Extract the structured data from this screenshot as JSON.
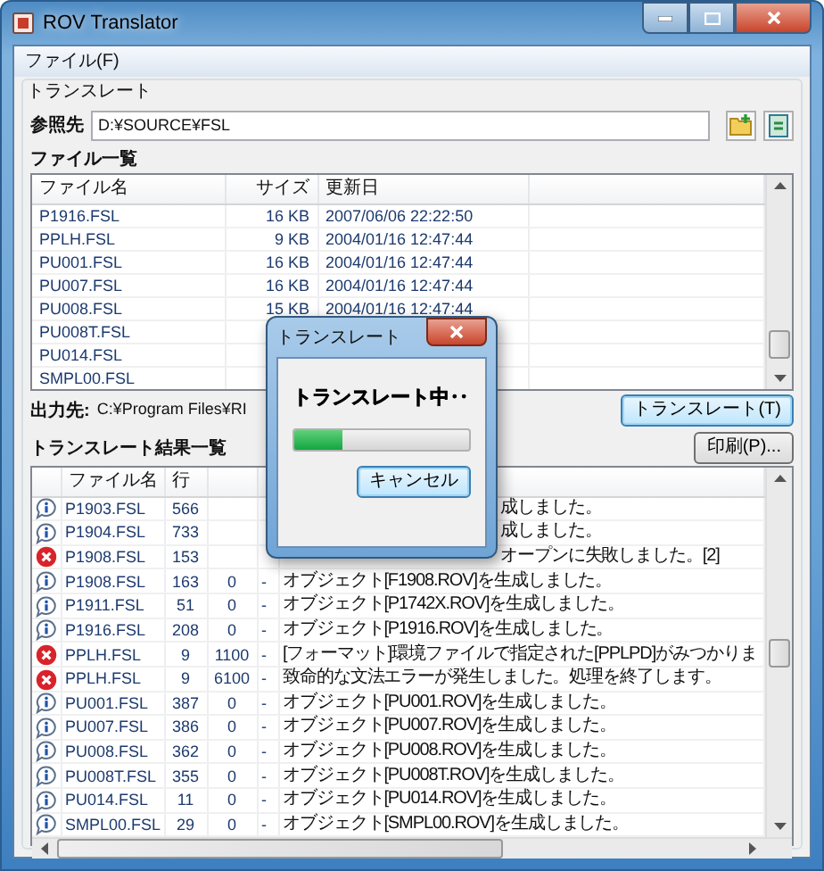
{
  "window": {
    "title": "ROV Translator"
  },
  "menu": [
    "ファイル(F)"
  ],
  "group": {
    "label": "トランスレート"
  },
  "source": {
    "label": "参照先",
    "value": "D:¥SOURCE¥FSL"
  },
  "file_list": {
    "title": "ファイル一覧",
    "columns": [
      "ファイル名",
      "サイズ",
      "更新日"
    ],
    "rows": [
      {
        "name": "P1916.FSL",
        "size": "16 KB",
        "date": "2007/06/06 22:22:50"
      },
      {
        "name": "PPLH.FSL",
        "size": "9 KB",
        "date": "2004/01/16 12:47:44"
      },
      {
        "name": "PU001.FSL",
        "size": "16 KB",
        "date": "2004/01/16 12:47:44"
      },
      {
        "name": "PU007.FSL",
        "size": "16 KB",
        "date": "2004/01/16 12:47:44"
      },
      {
        "name": "PU008.FSL",
        "size": "15 KB",
        "date": "2004/01/16 12:47:44"
      },
      {
        "name": "PU008T.FSL"
      },
      {
        "name": "PU014.FSL"
      },
      {
        "name": "SMPL00.FSL"
      }
    ]
  },
  "output": {
    "label": "出力先:",
    "value": "C:¥Program Files¥RI"
  },
  "translate_button": "トランスレート(T)",
  "print_button": "印刷(P)...",
  "results": {
    "title": "トランスレート結果一覧",
    "columns": [
      "ファイル名",
      "行"
    ],
    "rows": [
      {
        "kind": "info",
        "file": "P1903.FSL",
        "lines": "566",
        "message": "成しました。",
        "covered": true
      },
      {
        "kind": "info",
        "file": "P1904.FSL",
        "lines": "733",
        "message": "成しました。",
        "covered": true
      },
      {
        "kind": "error",
        "file": "P1908.FSL",
        "lines": "153",
        "message": "オープンに失敗しました。[2]",
        "covered": true
      },
      {
        "kind": "info",
        "file": "P1908.FSL",
        "lines": "163",
        "column_3": "0",
        "column_4": "-",
        "message": "オブジェクト[F1908.ROV]を生成しました。"
      },
      {
        "kind": "info",
        "file": "P1911.FSL",
        "lines": "51",
        "column_3": "0",
        "column_4": "-",
        "message": "オブジェクト[P1742X.ROV]を生成しました。"
      },
      {
        "kind": "info",
        "file": "P1916.FSL",
        "lines": "208",
        "column_3": "0",
        "column_4": "-",
        "message": "オブジェクト[P1916.ROV]を生成しました。"
      },
      {
        "kind": "error",
        "file": "PPLH.FSL",
        "lines": "9",
        "column_3": "1100",
        "column_4": "-",
        "message": "[フォーマット]環境ファイルで指定された[PPLPD]がみつかりま"
      },
      {
        "kind": "error",
        "file": "PPLH.FSL",
        "lines": "9",
        "column_3": "6100",
        "column_4": "-",
        "message": "致命的な文法エラーが発生しました。処理を終了します。"
      },
      {
        "kind": "info",
        "file": "PU001.FSL",
        "lines": "387",
        "column_3": "0",
        "column_4": "-",
        "message": "オブジェクト[PU001.ROV]を生成しました。"
      },
      {
        "kind": "info",
        "file": "PU007.FSL",
        "lines": "386",
        "column_3": "0",
        "column_4": "-",
        "message": "オブジェクト[PU007.ROV]を生成しました。"
      },
      {
        "kind": "info",
        "file": "PU008.FSL",
        "lines": "362",
        "column_3": "0",
        "column_4": "-",
        "message": "オブジェクト[PU008.ROV]を生成しました。"
      },
      {
        "kind": "info",
        "file": "PU008T.FSL",
        "lines": "355",
        "column_3": "0",
        "column_4": "-",
        "message": "オブジェクト[PU008T.ROV]を生成しました。"
      },
      {
        "kind": "info",
        "file": "PU014.FSL",
        "lines": "11",
        "column_3": "0",
        "column_4": "-",
        "message": "オブジェクト[PU014.ROV]を生成しました。"
      },
      {
        "kind": "info",
        "file": "SMPL00.FSL",
        "lines": "29",
        "column_3": "0",
        "column_4": "-",
        "message": "オブジェクト[SMPL00.ROV]を生成しました。"
      }
    ]
  },
  "dialog": {
    "title": "トランスレート",
    "message": "トランスレート中‥",
    "level": 0.28,
    "cancel": "キャンセル"
  }
}
